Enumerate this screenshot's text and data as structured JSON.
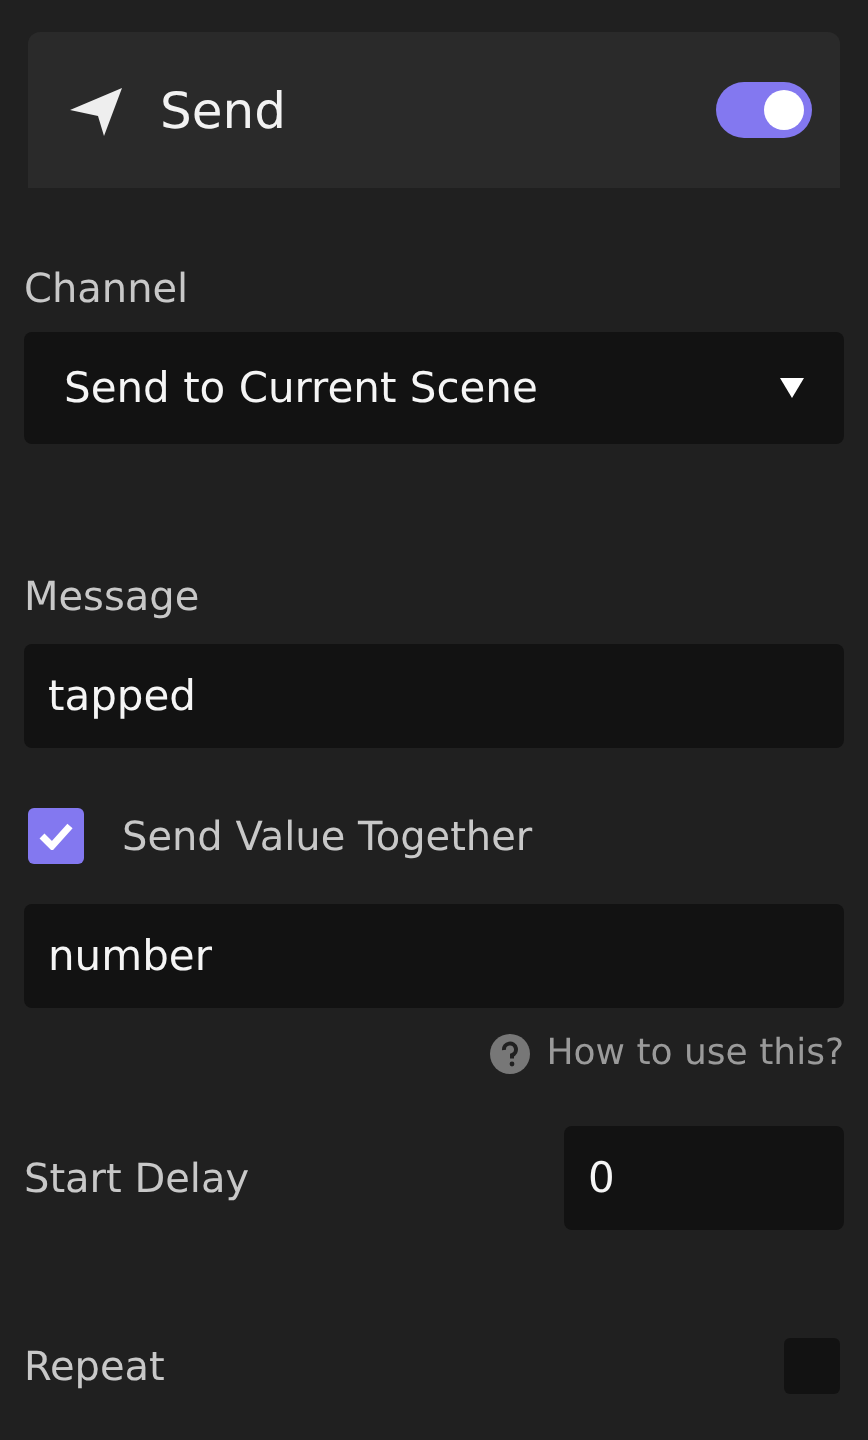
{
  "header": {
    "title": "Send",
    "enabled": true
  },
  "channel": {
    "label": "Channel",
    "value": "Send to Current Scene"
  },
  "message": {
    "label": "Message",
    "value": "tapped"
  },
  "send_value": {
    "label": "Send Value Together",
    "checked": true
  },
  "value_field": {
    "value": "number"
  },
  "help": {
    "label": "How to use this?"
  },
  "start_delay": {
    "label": "Start Delay",
    "value": "0"
  },
  "repeat": {
    "label": "Repeat",
    "checked": false
  }
}
